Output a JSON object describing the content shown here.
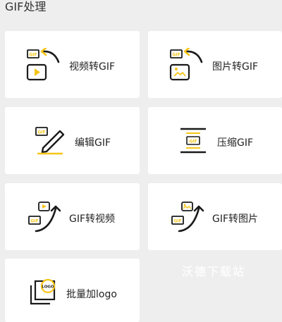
{
  "section": {
    "title": "GIF处理"
  },
  "cards": [
    {
      "label": "视频转GIF",
      "icon": "video-to-gif-icon"
    },
    {
      "label": "图片转GIF",
      "icon": "image-to-gif-icon"
    },
    {
      "label": "编辑GIF",
      "icon": "edit-gif-icon"
    },
    {
      "label": "压缩GIF",
      "icon": "compress-gif-icon"
    },
    {
      "label": "GIF转视频",
      "icon": "gif-to-video-icon"
    },
    {
      "label": "GIF转图片",
      "icon": "gif-to-image-icon"
    },
    {
      "label": "批量加logo",
      "icon": "batch-logo-icon"
    }
  ],
  "watermark": "沃德下载站",
  "colors": {
    "accent": "#f5c518",
    "ink": "#1a1a1a",
    "card": "#ffffff",
    "background": "#eeeeee"
  }
}
